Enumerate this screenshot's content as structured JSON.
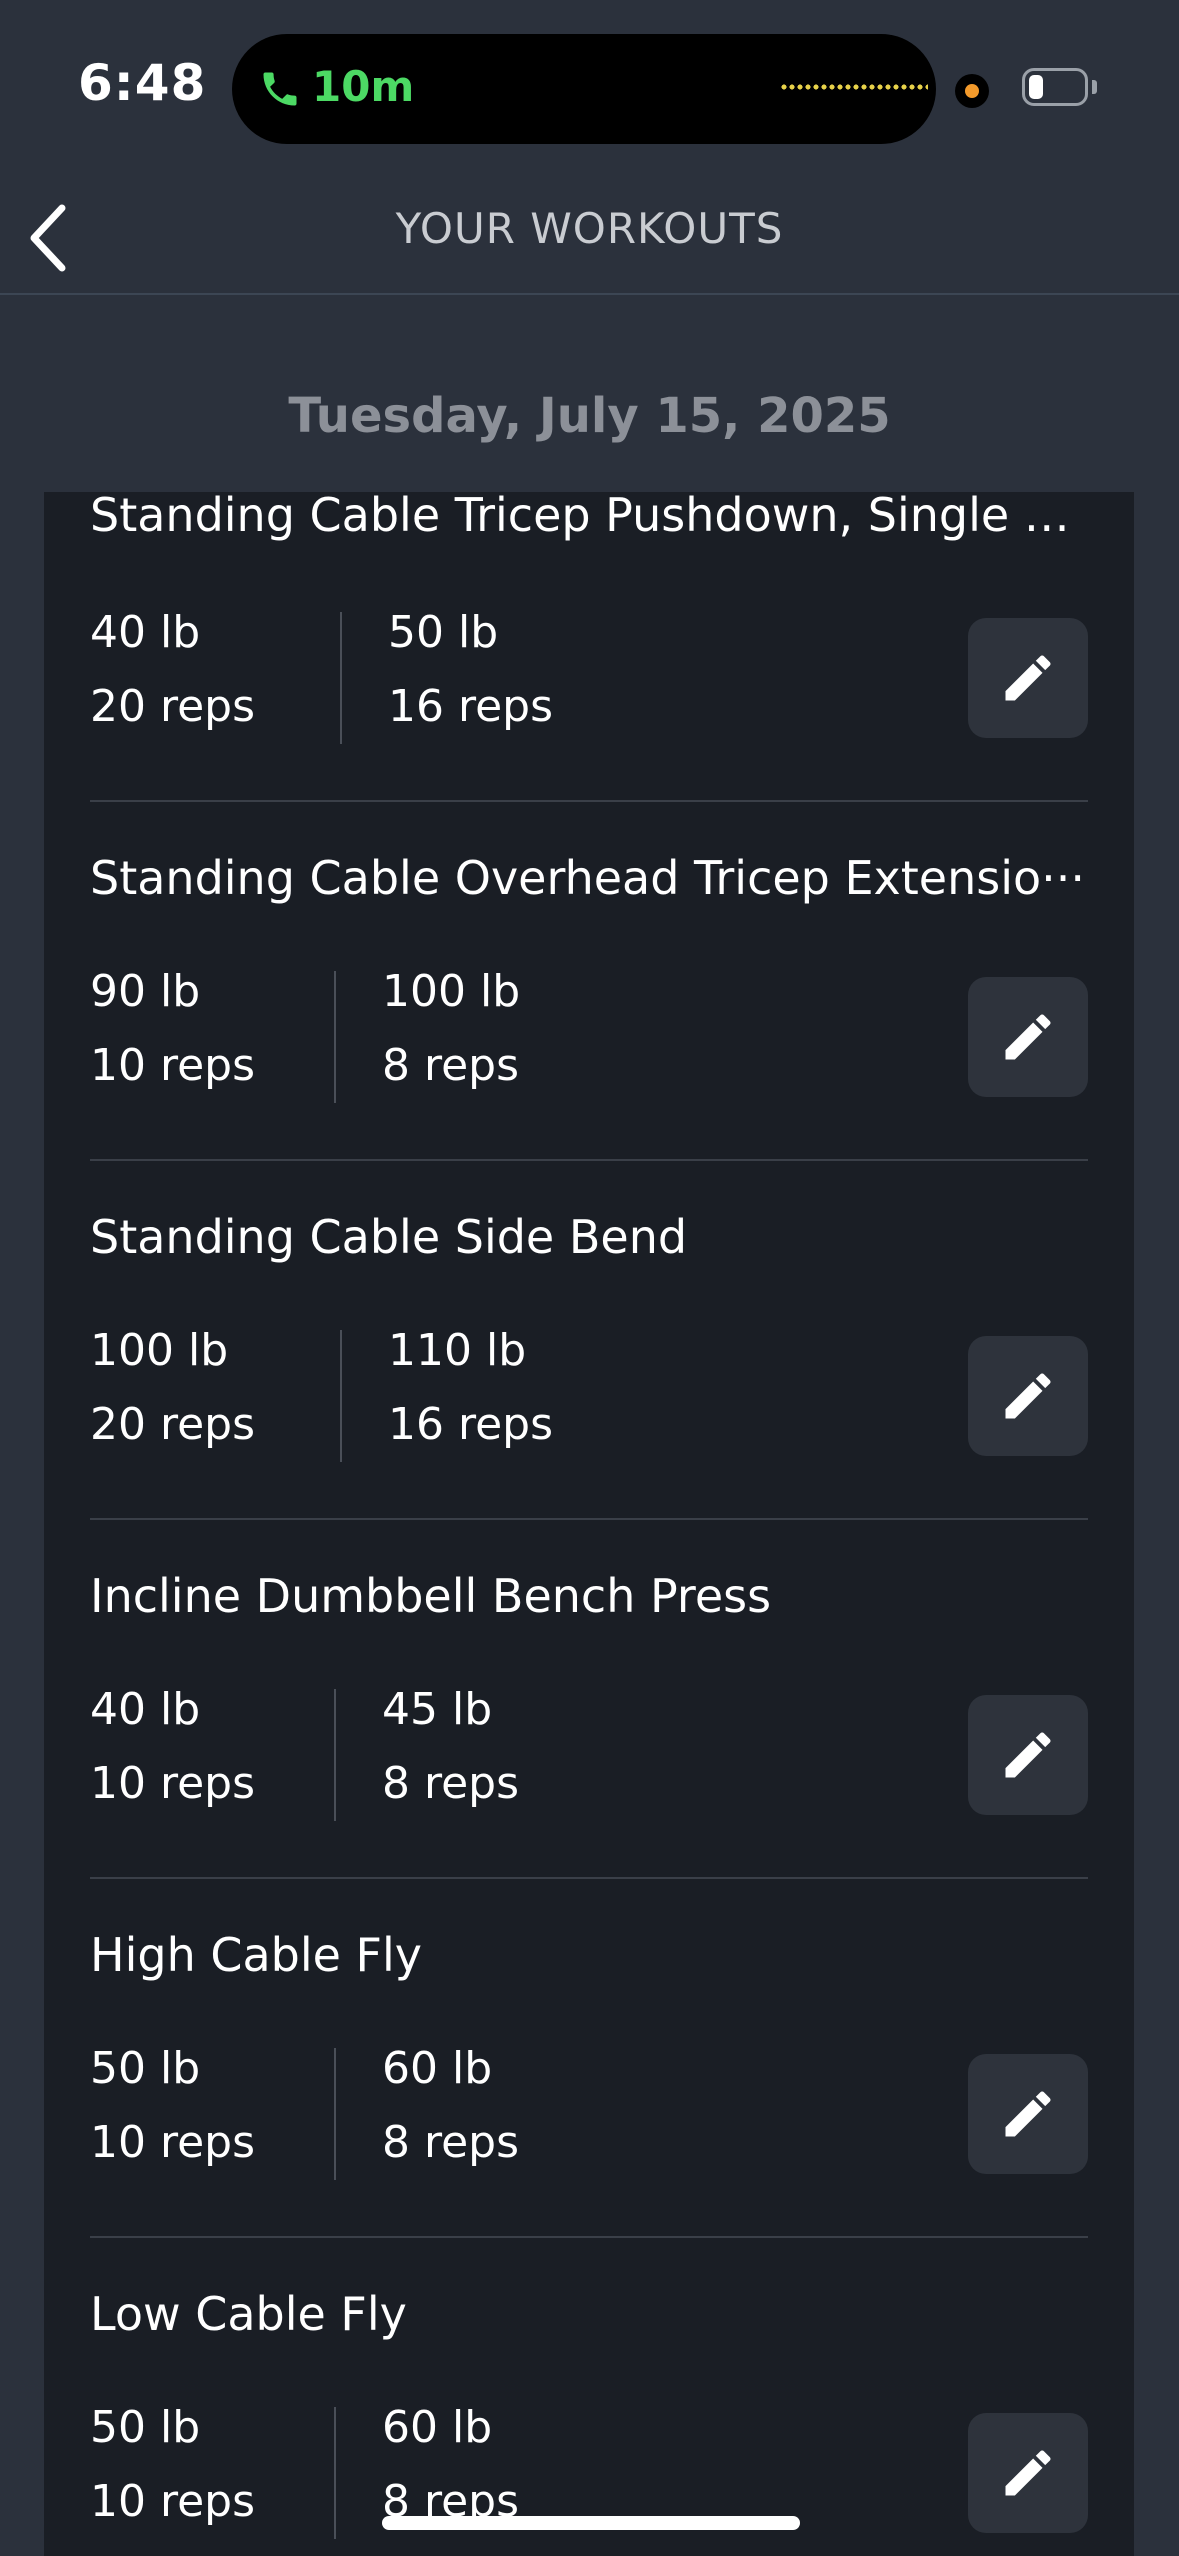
{
  "status_bar": {
    "time": "6:48",
    "call_duration": "10m",
    "icons": [
      "phone-icon",
      "camera-indicator-icon",
      "battery-icon"
    ],
    "call_color": "#4cd964",
    "indicator_color": "#f39a2b"
  },
  "header": {
    "title": "YOUR WORKOUTS",
    "back_icon": "chevron-left-icon"
  },
  "date": "Tuesday, July 15, 2025",
  "exercises": [
    {
      "name": "Standing Cable Tricep Pushdown, Single A···",
      "sets": [
        {
          "weight": "40 lb",
          "reps": "20 reps"
        },
        {
          "weight": "50 lb",
          "reps": "16 reps"
        }
      ]
    },
    {
      "name": "Standing Cable Overhead Tricep Extensio···",
      "sets": [
        {
          "weight": "90 lb",
          "reps": "10 reps"
        },
        {
          "weight": "100 lb",
          "reps": "8 reps"
        }
      ]
    },
    {
      "name": "Standing Cable Side Bend",
      "sets": [
        {
          "weight": "100 lb",
          "reps": "20 reps"
        },
        {
          "weight": "110 lb",
          "reps": "16 reps"
        }
      ]
    },
    {
      "name": "Incline Dumbbell Bench Press",
      "sets": [
        {
          "weight": "40 lb",
          "reps": "10 reps"
        },
        {
          "weight": "45 lb",
          "reps": "8 reps"
        }
      ]
    },
    {
      "name": "High Cable Fly",
      "sets": [
        {
          "weight": "50 lb",
          "reps": "10 reps"
        },
        {
          "weight": "60 lb",
          "reps": "8 reps"
        }
      ]
    },
    {
      "name": "Low Cable Fly",
      "sets": [
        {
          "weight": "50 lb",
          "reps": "10 reps"
        },
        {
          "weight": "60 lb",
          "reps": "8 reps"
        }
      ]
    }
  ],
  "edit_icon": "pencil-icon",
  "colors": {
    "background": "#2b313c",
    "card": "#1a1e25",
    "edit_button": "#2e333c",
    "title": "#c9ccd1",
    "date": "#8c9098"
  }
}
